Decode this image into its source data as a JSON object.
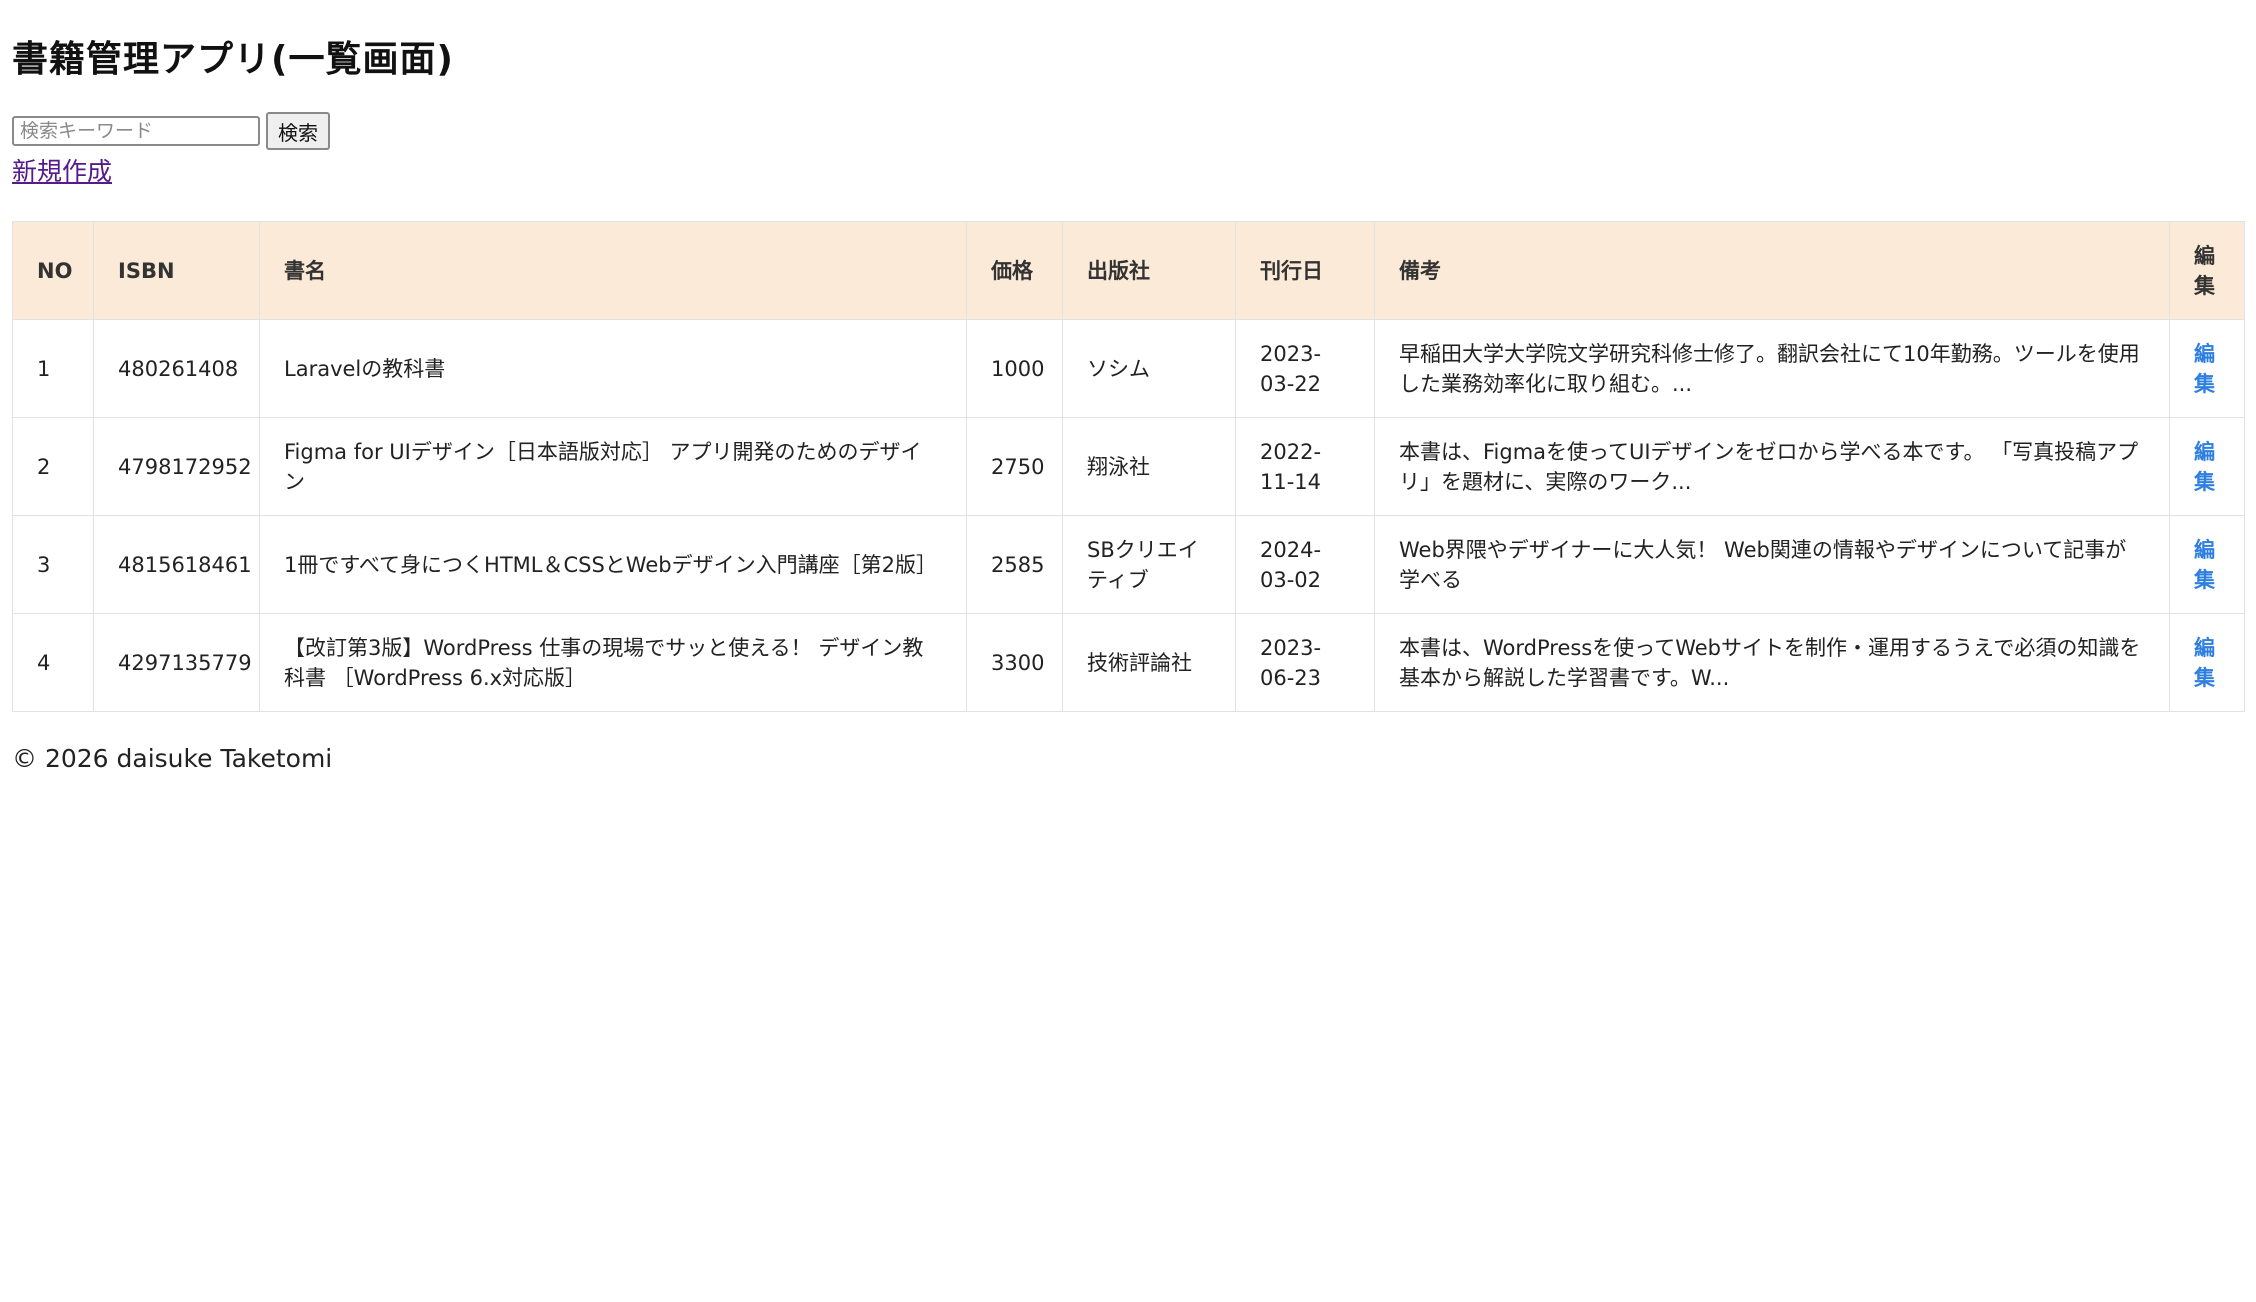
{
  "header": {
    "title": "書籍管理アプリ(一覧画面)"
  },
  "search": {
    "placeholder": "検索キーワード",
    "value": "",
    "button_label": "検索"
  },
  "new_link": "新規作成",
  "table": {
    "columns": [
      "NO",
      "ISBN",
      "書名",
      "価格",
      "出版社",
      "刊行日",
      "備考",
      "編集"
    ],
    "rows": [
      {
        "no": "1",
        "isbn": "480261408",
        "title": "Laravelの教科書",
        "price": "1000",
        "publisher": "ソシム",
        "date": "2023-03-22",
        "note": "早稲田大学大学院文学研究科修士修了。翻訳会社にて10年勤務。ツールを使用した業務効率化に取り組む。...",
        "edit": "編集"
      },
      {
        "no": "2",
        "isbn": "4798172952",
        "title": "Figma for UIデザイン［日本語版対応］ アプリ開発のためのデザイン",
        "price": "2750",
        "publisher": "翔泳社",
        "date": "2022-11-14",
        "note": "本書は、Figmaを使ってUIデザインをゼロから学べる本です。 「写真投稿アプリ」を題材に、実際のワーク...",
        "edit": "編集"
      },
      {
        "no": "3",
        "isbn": "4815618461",
        "title": "1冊ですべて身につくHTML＆CSSとWebデザイン入門講座［第2版］",
        "price": "2585",
        "publisher": "SBクリエイティブ",
        "date": "2024-03-02",
        "note": "Web界隈やデザイナーに大人気！ Web関連の情報やデザインについて記事が学べる",
        "edit": "編集"
      },
      {
        "no": "4",
        "isbn": "4297135779",
        "title": "【改訂第3版】WordPress 仕事の現場でサッと使える！ デザイン教科書 ［WordPress 6.x対応版］",
        "price": "3300",
        "publisher": "技術評論社",
        "date": "2023-06-23",
        "note": "本書は、WordPressを使ってWebサイトを制作・運用するうえで必須の知識を基本から解説した学習書です。W...",
        "edit": "編集"
      }
    ]
  },
  "footer": {
    "copyright": "© 2026 daisuke Taketomi"
  },
  "colors": {
    "header_bg": "#fbead7",
    "edit_link": "#2f7fe0",
    "visited_link": "#551a8b"
  }
}
